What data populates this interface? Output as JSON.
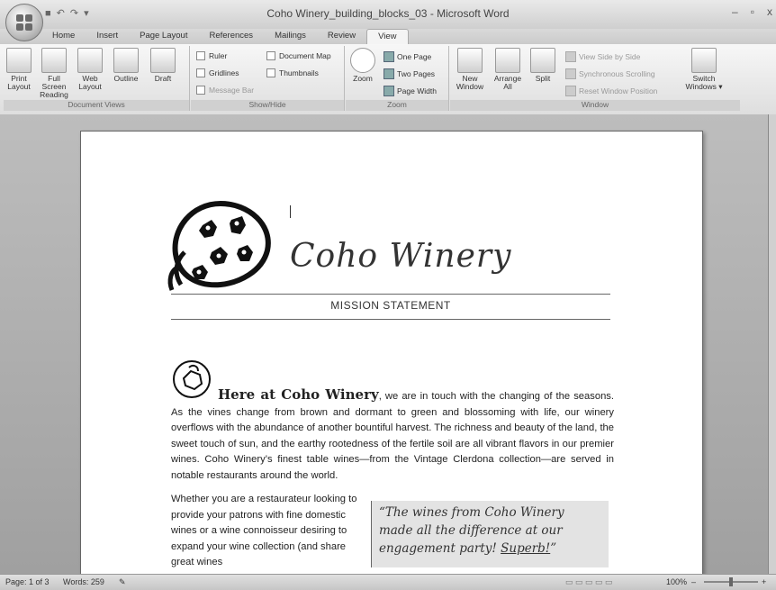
{
  "window": {
    "title": "Coho Winery_building_blocks_03 - Microsoft Word",
    "controls": [
      "–",
      "▫",
      "x"
    ]
  },
  "tabs": [
    "Home",
    "Insert",
    "Page Layout",
    "References",
    "Mailings",
    "Review",
    "View"
  ],
  "active_tab": "View",
  "ribbon": {
    "document_views": {
      "label": "Document Views",
      "buttons": [
        "Print Layout",
        "Full Screen Reading",
        "Web Layout",
        "Outline",
        "Draft"
      ]
    },
    "show_hide": {
      "label": "Show/Hide",
      "items": [
        "Ruler",
        "Gridlines",
        "Message Bar",
        "Document Map",
        "Thumbnails"
      ]
    },
    "zoom": {
      "label": "Zoom",
      "zoom_button": "Zoom",
      "small": [
        "One Page",
        "Two Pages",
        "Page Width"
      ]
    },
    "window": {
      "label": "Window",
      "buttons": [
        "New Window",
        "Arrange All",
        "Split"
      ],
      "side_items": [
        "View Side by Side",
        "Synchronous Scrolling",
        "Reset Window Position"
      ],
      "switch": "Switch Windows"
    }
  },
  "document": {
    "brand": "Coho Winery",
    "section_title": "MISSION STATEMENT",
    "lead": "Here at Coho Winery",
    "paragraph": ", we are in touch with the changing of the seasons. As the vines change from brown and dormant to green and blossoming with life, our winery overflows with the abundance of another bountiful harvest. The richness and beauty of the land, the sweet touch of sun, and the earthy rootedness of the fertile soil are all vibrant flavors in our premier wines. Coho Winery’s finest table wines—from the Vintage Clerdona collection—are served in notable restaurants around the world.",
    "column_text": "Whether you are a restaurateur looking to provide your patrons with fine domestic wines or a wine connoisseur desiring to expand your wine collection (and share great wines",
    "quote_main": "“The wines from Coho Winery made all the difference at our engagement party! ",
    "quote_emphasis": "Superb!",
    "quote_end": "”"
  },
  "status": {
    "page": "Page: 1 of 3",
    "words": "Words: 259",
    "zoom": "100%"
  }
}
